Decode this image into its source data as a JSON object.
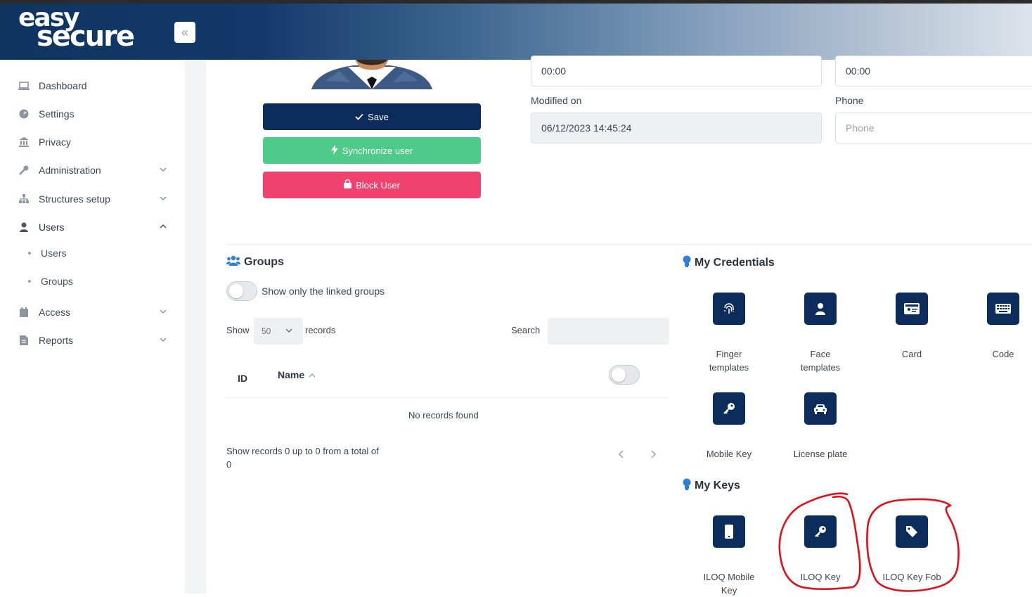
{
  "brand": {
    "line1": "easy",
    "line2": "secure"
  },
  "sidebar": {
    "items": [
      {
        "label": "Dashboard"
      },
      {
        "label": "Settings"
      },
      {
        "label": "Privacy"
      },
      {
        "label": "Administration"
      },
      {
        "label": "Structures setup"
      },
      {
        "label": "Users"
      },
      {
        "label": "Access"
      },
      {
        "label": "Reports"
      }
    ],
    "sub_items": [
      {
        "label": "Users"
      },
      {
        "label": "Groups"
      }
    ]
  },
  "profile": {
    "save_label": "Save",
    "sync_label": "Synchronize user",
    "block_label": "Block User"
  },
  "form": {
    "time1_value": "00:00",
    "time2_value": "00:00",
    "modified_label": "Modified on",
    "modified_value": "06/12/2023 14:45:24",
    "phone_label": "Phone",
    "phone_placeholder": "Phone"
  },
  "groups": {
    "title": "Groups",
    "toggle_label": "Show only the linked groups",
    "show_label": "Show",
    "page_size": "50",
    "records_label": "records",
    "search_label": "Search",
    "col_id": "ID",
    "col_name": "Name",
    "empty_text": "No records found",
    "footer_line1": "Show records 0 up to 0 from a total of",
    "footer_line2": "0"
  },
  "credentials": {
    "title": "My Credentials",
    "items": [
      {
        "label_1": "Finger",
        "label_2": "templates",
        "icon": "fingerprint-icon"
      },
      {
        "label_1": "Face",
        "label_2": "templates",
        "icon": "user-icon"
      },
      {
        "label_1": "Card",
        "label_2": "",
        "icon": "id-card-icon"
      },
      {
        "label_1": "Code",
        "label_2": "",
        "icon": "keyboard-icon"
      },
      {
        "label_1": "Mobile Key",
        "label_2": "",
        "icon": "key-icon"
      },
      {
        "label_1": "License plate",
        "label_2": "",
        "icon": "car-icon"
      }
    ]
  },
  "keys": {
    "title": "My Keys",
    "items": [
      {
        "label_1": "ILOQ Mobile",
        "label_2": "Key",
        "icon": "mobile-icon"
      },
      {
        "label_1": "ILOQ Key",
        "label_2": "",
        "icon": "key-icon"
      },
      {
        "label_1": "ILOQ Key Fob",
        "label_2": "",
        "icon": "tag-icon"
      }
    ]
  },
  "colors": {
    "navy": "#0c2d5b",
    "green": "#4fcb89",
    "pink": "#f0426e",
    "annotation_red": "#e0101a"
  }
}
